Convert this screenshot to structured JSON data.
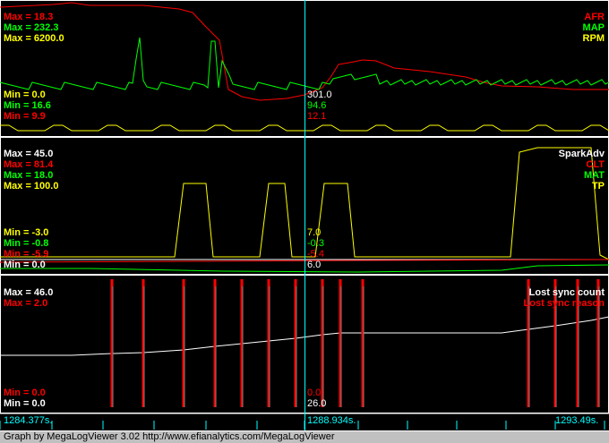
{
  "colors": {
    "afr": "#ff0000",
    "map": "#00ff00",
    "rpm": "#ffff00",
    "white": "#ffffff",
    "cursor": "#00ffff",
    "grid": "#808080"
  },
  "panels": [
    {
      "labels_max": [
        {
          "text": "Max = 18.3",
          "color": "#ff0000"
        },
        {
          "text": "Max = 232.3",
          "color": "#00ff00"
        },
        {
          "text": "Max = 6200.0",
          "color": "#ffff00"
        }
      ],
      "labels_min": [
        {
          "text": "Min = 0.0",
          "color": "#ffff00"
        },
        {
          "text": "Min = 16.6",
          "color": "#00ff00"
        },
        {
          "text": "Min = 9.9",
          "color": "#ff0000"
        }
      ],
      "legend": [
        {
          "text": "AFR",
          "color": "#ff0000"
        },
        {
          "text": "MAP",
          "color": "#00ff00"
        },
        {
          "text": "RPM",
          "color": "#ffff00"
        }
      ],
      "cursor_values": [
        {
          "text": "301.0",
          "color": "#ffffff"
        },
        {
          "text": "94.6",
          "color": "#00ff00"
        },
        {
          "text": "12.1",
          "color": "#ff0000"
        }
      ]
    },
    {
      "labels_max": [
        {
          "text": "Max = 45.0",
          "color": "#ffffff"
        },
        {
          "text": "Max = 81.4",
          "color": "#ff0000"
        },
        {
          "text": "Max = 18.0",
          "color": "#00ff00"
        },
        {
          "text": "Max = 100.0",
          "color": "#ffff00"
        }
      ],
      "labels_min": [
        {
          "text": "Min = -3.0",
          "color": "#ffff00"
        },
        {
          "text": "Min = -0.8",
          "color": "#00ff00"
        },
        {
          "text": "Min = -5.9",
          "color": "#ff0000"
        },
        {
          "text": "Min = 0.0",
          "color": "#ffffff"
        }
      ],
      "legend": [
        {
          "text": "SparkAdv",
          "color": "#ffffff"
        },
        {
          "text": "CLT",
          "color": "#ff0000"
        },
        {
          "text": "MAT",
          "color": "#00ff00"
        },
        {
          "text": "TP",
          "color": "#ffff00"
        }
      ],
      "cursor_values": [
        {
          "text": "7.0",
          "color": "#ffff00"
        },
        {
          "text": "-0.3",
          "color": "#00ff00"
        },
        {
          "text": "-5.4",
          "color": "#ff0000"
        },
        {
          "text": "6.0",
          "color": "#ffffff"
        }
      ]
    },
    {
      "labels_max": [
        {
          "text": "Max = 46.0",
          "color": "#ffffff"
        },
        {
          "text": "Max = 2.0",
          "color": "#ff0000"
        }
      ],
      "labels_min": [
        {
          "text": "Min = 0.0",
          "color": "#ff0000"
        },
        {
          "text": "Min = 0.0",
          "color": "#ffffff"
        }
      ],
      "legend": [
        {
          "text": "Lost sync count",
          "color": "#ffffff"
        },
        {
          "text": "Lost sync reason",
          "color": "#ff0000"
        }
      ],
      "cursor_values": [
        {
          "text": "0.0",
          "color": "#ff0000"
        },
        {
          "text": "26.0",
          "color": "#ffffff"
        }
      ]
    }
  ],
  "time_axis": {
    "left": "1284.377s.",
    "cursor": "1288.934s.",
    "right": "1293.49s."
  },
  "status_bar": "Graph by MegaLogViewer 3.02 http://www.efianalytics.com/MegaLogViewer"
}
